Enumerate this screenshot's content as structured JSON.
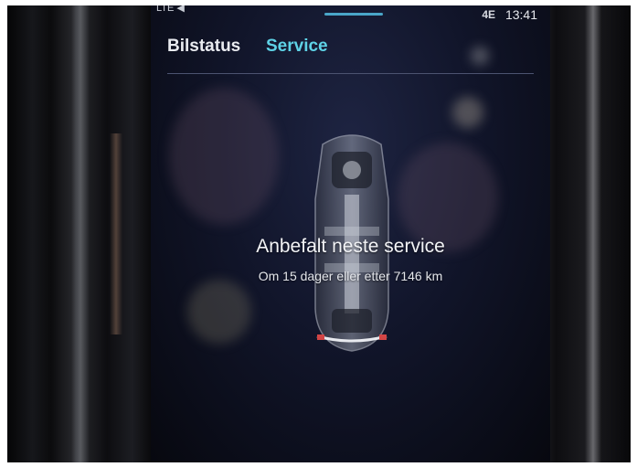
{
  "status_bar": {
    "left_text": "LTE ◀",
    "network_label": "4E",
    "time": "13:41"
  },
  "tabs": [
    {
      "label": "Bilstatus",
      "active": false
    },
    {
      "label": "Service",
      "active": true
    }
  ],
  "service": {
    "title": "Anbefalt neste service",
    "details": "Om 15 dager eller etter 7146 km"
  },
  "icons": {
    "car": "car-topview-icon"
  },
  "colors": {
    "active_tab": "#5ed2e6",
    "inactive_tab": "#e9ebf0",
    "screen_background": "#11152a",
    "tab_indicator": "#4aa6c8"
  }
}
